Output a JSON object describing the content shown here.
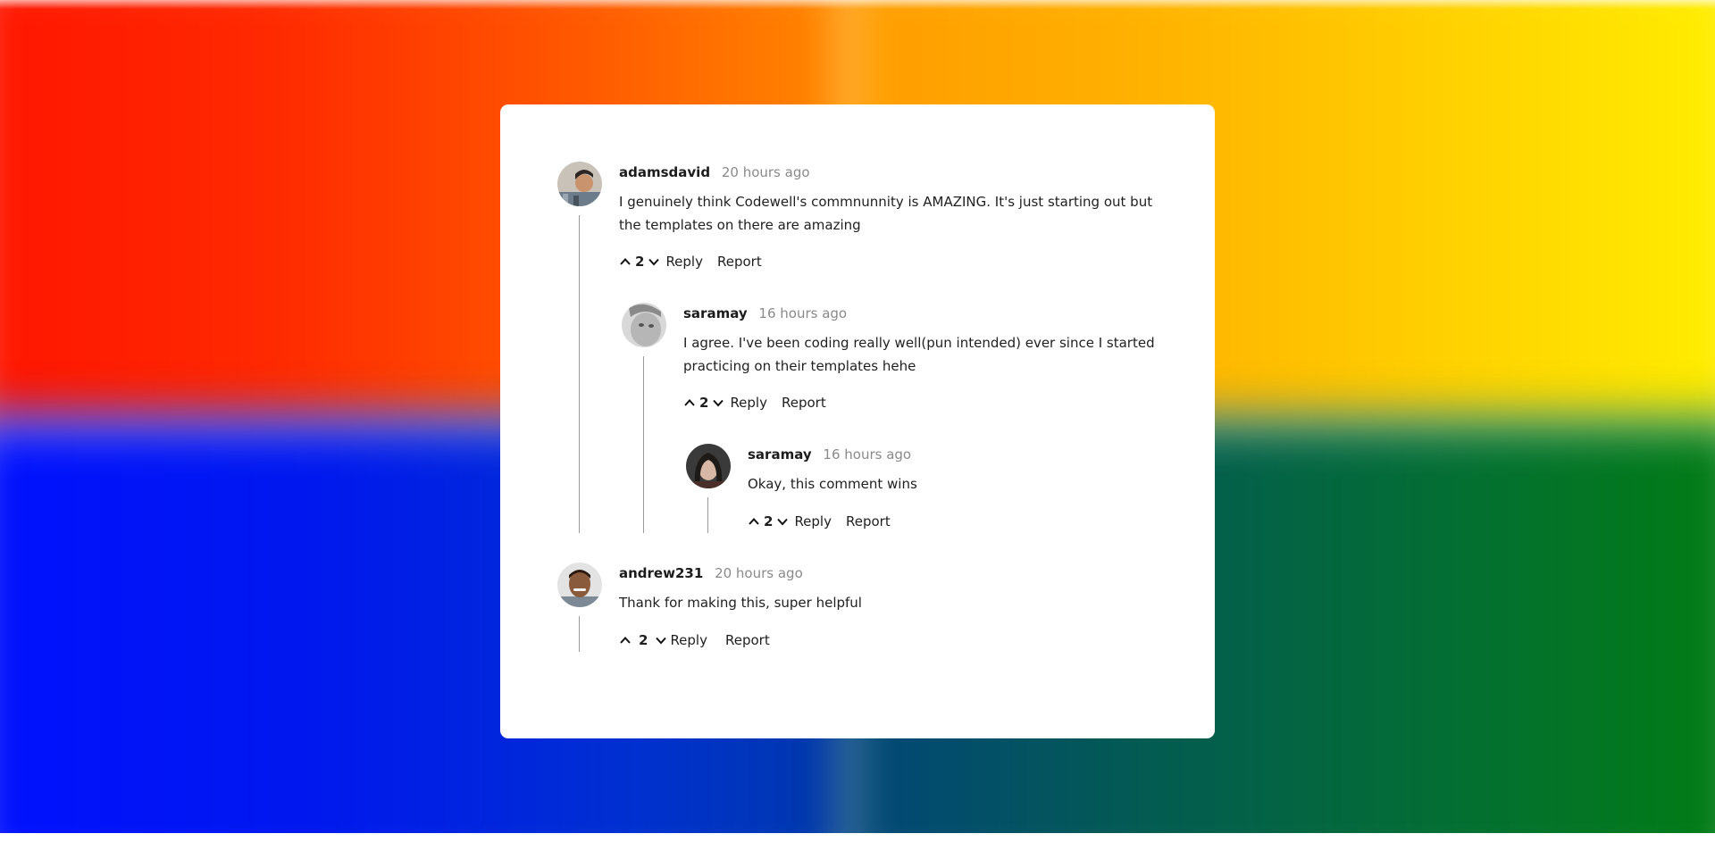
{
  "comments": {
    "c1": {
      "username": "adamsdavid",
      "time": "20 hours ago",
      "text_line1": "I genuinely think Codewell's commnunnity is AMAZING. It's just starting out but",
      "text_line2": "the templates on there are amazing",
      "votes": "2",
      "reply_label": "Reply",
      "report_label": "Report"
    },
    "c2": {
      "username": "saramay",
      "time": "16 hours ago",
      "text_line1": "I agree. I've been coding really well(pun intended) ever since I started",
      "text_line2": "practicing on their templates hehe",
      "votes": "2",
      "reply_label": "Reply",
      "report_label": "Report"
    },
    "c3": {
      "username": "saramay",
      "time": "16 hours ago",
      "text_line1": "Okay, this comment wins",
      "votes": "2",
      "reply_label": "Reply",
      "report_label": "Report"
    },
    "c4": {
      "username": "andrew231",
      "time": "20 hours ago",
      "text_line1": "Thank for making this, super helpful",
      "votes": "2",
      "reply_label": "Reply",
      "report_label": "Report"
    }
  },
  "icons": {
    "upvote": "chevron-up-icon",
    "downvote": "chevron-down-icon",
    "avatar": "user-avatar"
  },
  "colors": {
    "card_background": "#ffffff",
    "username": "#1c1c1c",
    "timestamp": "#8a8a8a",
    "thread_line": "#9a9a9a",
    "background_top_left": "#ff1400",
    "background_top_right": "#fff000",
    "background_bottom_left": "#0010ff",
    "background_bottom_right": "#027d12"
  }
}
